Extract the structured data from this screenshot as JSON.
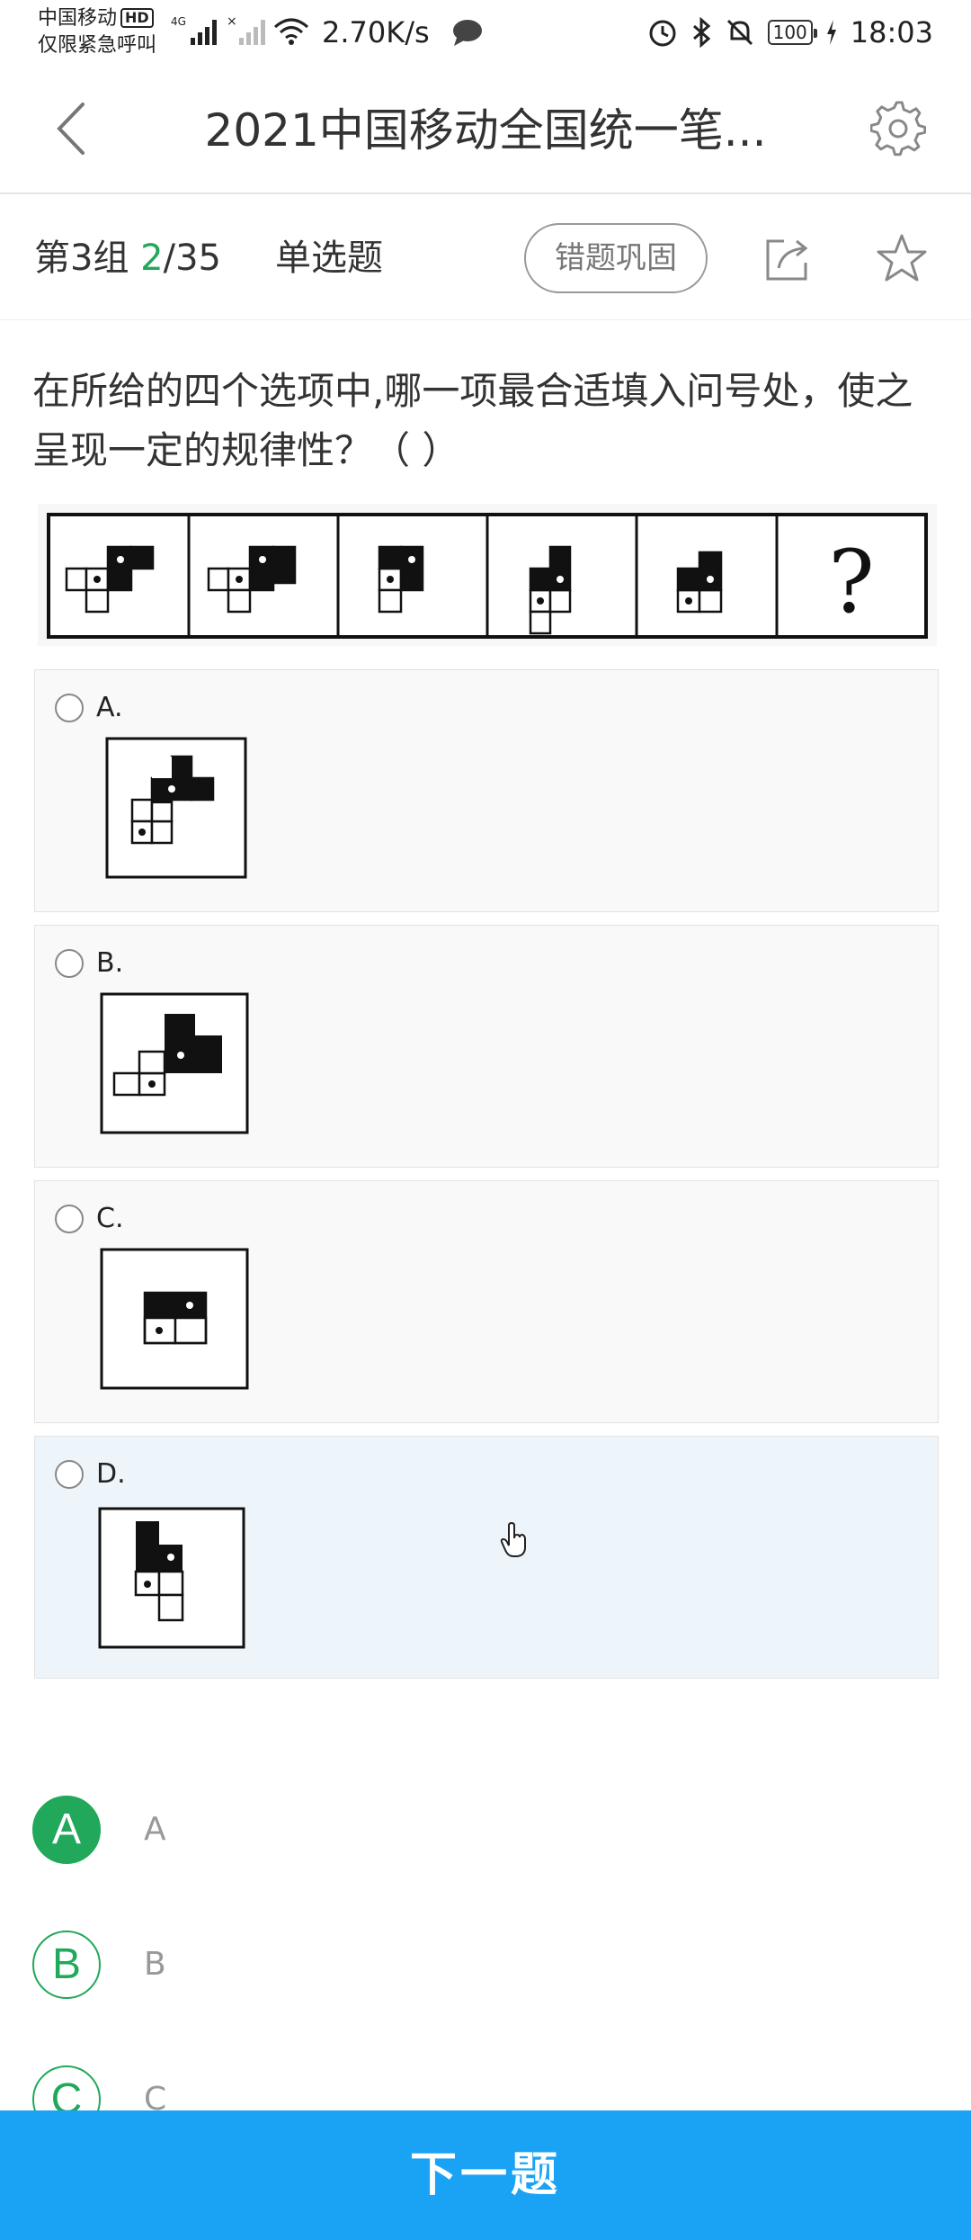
{
  "status_bar": {
    "carrier_line1": "中国移动",
    "hd_badge": "HD",
    "carrier_line2": "仅限紧急呼叫",
    "network_speed": "2.70K/s",
    "battery": "100",
    "time": "18:03"
  },
  "header": {
    "title": "2021中国移动全国统一笔..."
  },
  "sub_header": {
    "group": "第3组",
    "current": "2",
    "total": "/35",
    "question_type": "单选题",
    "review_button": "错题巩固"
  },
  "question": {
    "text": "在所给的四个选项中,哪一项最合适填入问号处，使之呈现一定的规律性？（ ）",
    "figure_placeholder": "?"
  },
  "options": [
    {
      "letter": "A."
    },
    {
      "letter": "B."
    },
    {
      "letter": "C."
    },
    {
      "letter": "D."
    }
  ],
  "choices": [
    {
      "circle": "A",
      "text": "A",
      "selected": true
    },
    {
      "circle": "B",
      "text": "B",
      "selected": false
    },
    {
      "circle": "C",
      "text": "C",
      "selected": false
    }
  ],
  "next_button": "下一题",
  "colors": {
    "accent_green": "#21a85a",
    "next_button_blue": "#1aa3f4",
    "highlight_option_bg": "#eef5fa"
  }
}
